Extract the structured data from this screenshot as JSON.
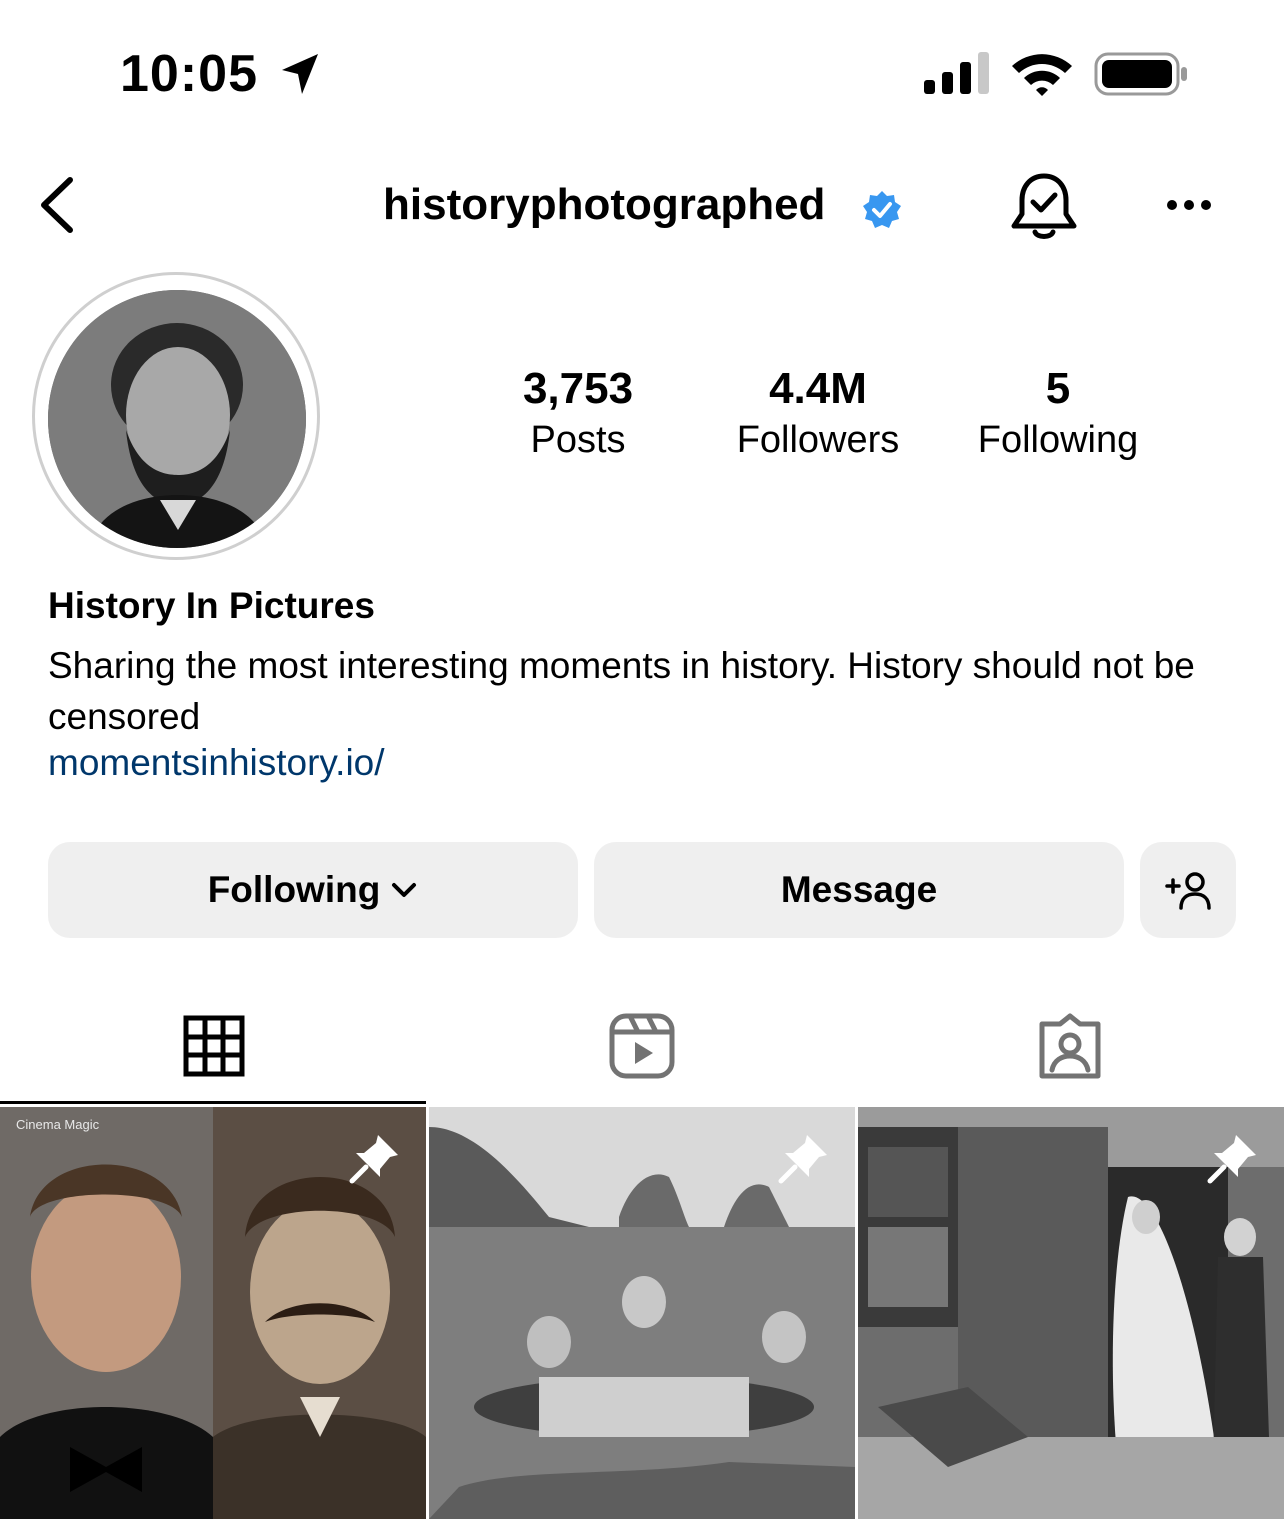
{
  "status_bar": {
    "time": "10:05",
    "icons": [
      "location-arrow-icon",
      "signal-icon",
      "wifi-icon",
      "battery-icon"
    ]
  },
  "header": {
    "username": "historyphotographed",
    "verified": true,
    "icons": [
      "back-icon",
      "verified-badge-icon",
      "notification-bell-icon",
      "more-icon"
    ]
  },
  "profile": {
    "stats": [
      {
        "value": "3,753",
        "label": "Posts"
      },
      {
        "value": "4.4M",
        "label": "Followers"
      },
      {
        "value": "5",
        "label": "Following"
      }
    ],
    "display_name": "History In Pictures",
    "bio": "Sharing the most interesting moments in history. History should not be censored",
    "link": "momentsinhistory.io/"
  },
  "actions": {
    "following_label": "Following",
    "message_label": "Message"
  },
  "tabs": [
    "grid-icon",
    "reels-icon",
    "tagged-icon"
  ],
  "posts": [
    {
      "overlay_text": "Cinema Magic",
      "pinned": true
    },
    {
      "pinned": true
    },
    {
      "pinned": true
    }
  ],
  "colors": {
    "link": "#00376b",
    "verified": "#3897f0",
    "button_bg": "#efefef"
  }
}
